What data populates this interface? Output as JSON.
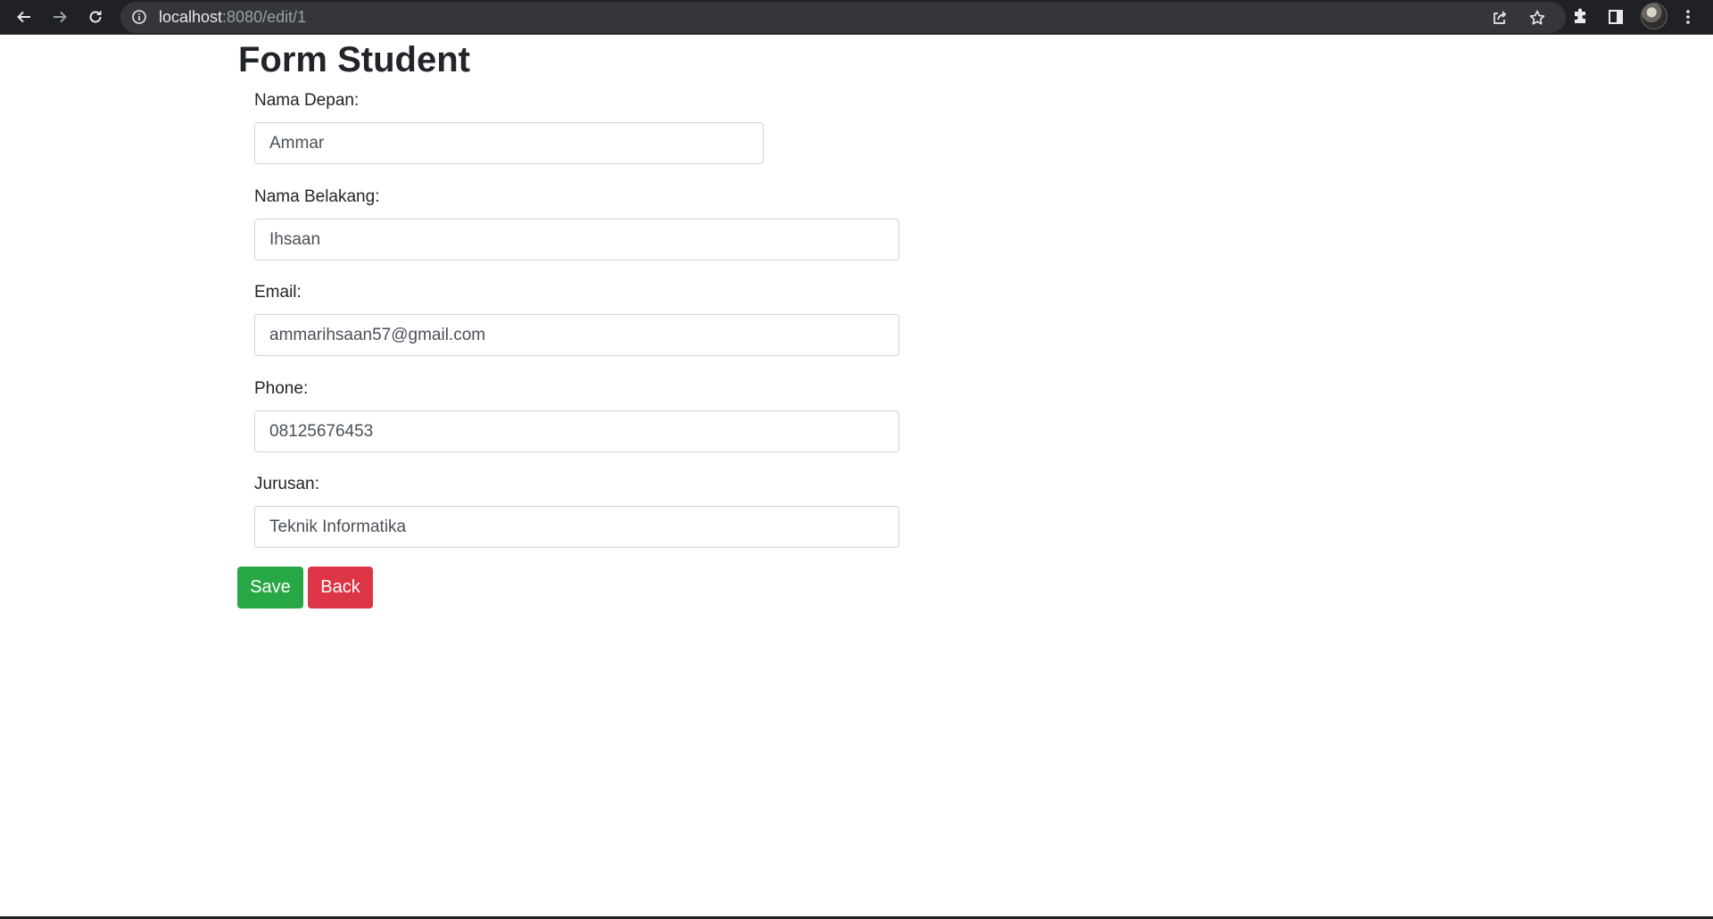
{
  "browser": {
    "url_host": "localhost",
    "url_path": ":8080/edit/1",
    "icons": [
      "back-icon",
      "forward-icon",
      "reload-icon",
      "info-icon",
      "share-icon",
      "star-icon",
      "extensions-icon",
      "side-panel-icon",
      "profile-avatar",
      "menu-icon"
    ]
  },
  "page": {
    "title": "Form Student"
  },
  "form": {
    "fields": [
      {
        "label": "Nama Depan:",
        "value": "Ammar"
      },
      {
        "label": "Nama Belakang:",
        "value": "Ihsaan"
      },
      {
        "label": "Email:",
        "value": "ammarihsaan57@gmail.com"
      },
      {
        "label": "Phone:",
        "value": "08125676453"
      },
      {
        "label": "Jurusan:",
        "value": "Teknik Informatika"
      }
    ],
    "save_label": "Save",
    "back_label": "Back"
  },
  "colors": {
    "save": "#28a745",
    "back": "#dc3545",
    "chrome": "#202124",
    "omnibox": "#35363a"
  }
}
